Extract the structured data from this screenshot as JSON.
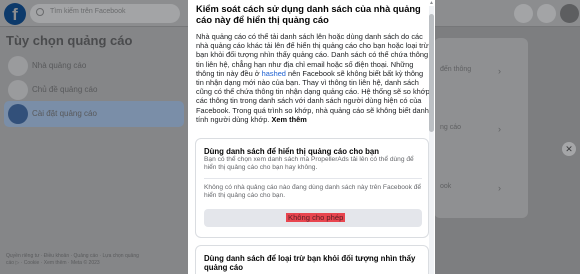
{
  "topbar": {
    "logo": "f",
    "search_placeholder": "Tìm kiếm trên Facebook"
  },
  "sidebar": {
    "title": "Tùy chọn quảng cáo",
    "items": [
      {
        "label": "Nhà quảng cáo",
        "active": false
      },
      {
        "label": "Chủ đề quảng cáo",
        "active": false
      },
      {
        "label": "Cài đặt quảng cáo",
        "active": true
      }
    ],
    "footer": "Quyền riêng tư · Điều khoản · Quảng cáo · Lựa chọn quảng cáo ▷ · Cookie · Xem thêm · Meta © 2023"
  },
  "background_main": {
    "lines": [
      "đến thông",
      "ng cáo",
      "ook"
    ]
  },
  "modal": {
    "title": "Kiểm soát cách sử dụng danh sách của nhà quảng cáo này để hiển thị quảng cáo",
    "desc_part1": "Nhà quảng cáo có thể tải danh sách lên hoặc dùng danh sách do các nhà quảng cáo khác tải lên để hiển thị quảng cáo cho bạn hoặc loại trừ bạn khỏi đối tượng nhìn thấy quảng cáo. Danh sách có thể chứa thông tin liên hệ, chẳng hạn như địa chỉ email hoặc số điện thoại. Những thông tin này đều ở ",
    "desc_link": "hashed",
    "desc_part2": " nên Facebook sẽ không biết bất kỳ thông tin nhận dạng mới nào của bạn. Thay vì thông tin liên hệ, danh sách cũng có thể chứa thông tin nhận dạng quảng cáo. Hệ thống sẽ so khớp các thông tin trong danh sách với danh sách người dùng hiện có của Facebook. Trong quá trình so khớp, nhà quảng cáo sẽ không biết danh tính người dùng khớp. ",
    "see_more": "Xem thêm",
    "card1": {
      "title": "Dùng danh sách để hiển thị quảng cáo cho bạn",
      "subtitle": "Bạn có thể chọn xem danh sách mà PropellerAds tải lên có thể dùng để hiển thị quảng cáo cho bạn hay không.",
      "note": "Không có nhà quảng cáo nào đang dùng danh sách này trên Facebook để hiển thị quảng cáo cho bạn.",
      "button": "Không cho phép"
    },
    "card2": {
      "title": "Dùng danh sách để loại trừ bạn khỏi đối tượng nhìn thấy quảng cáo"
    }
  },
  "colors": {
    "accent": "#1b5fd1",
    "highlight": "#e8454f"
  }
}
